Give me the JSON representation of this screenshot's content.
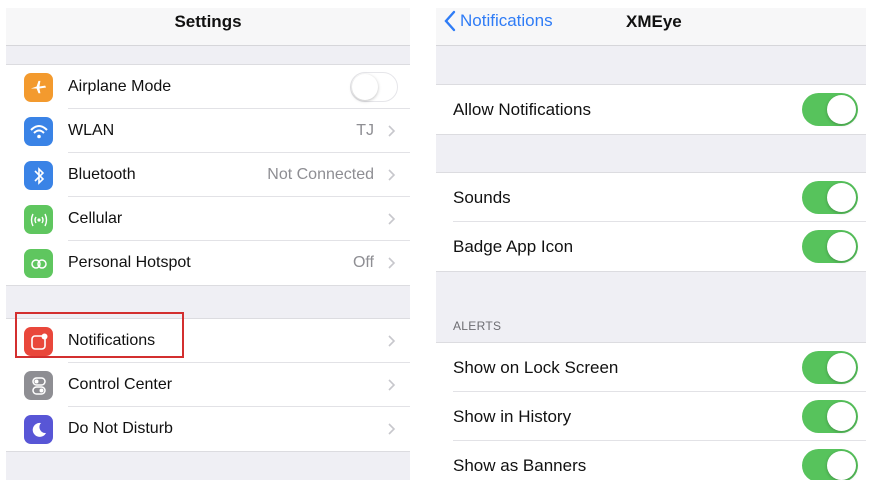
{
  "left_panel": {
    "title": "Settings",
    "groups": [
      {
        "items": [
          {
            "label": "Airplane Mode",
            "icon": "airplane-icon",
            "icon_color": "#f39a2e",
            "value": "",
            "toggle": "off"
          },
          {
            "label": "WLAN",
            "icon": "wifi-icon",
            "icon_color": "#3a83e6",
            "value": "TJ"
          },
          {
            "label": "Bluetooth",
            "icon": "bluetooth-icon",
            "icon_color": "#3a83e6",
            "value": "Not Connected"
          },
          {
            "label": "Cellular",
            "icon": "cellular-icon",
            "icon_color": "#5fc65f",
            "value": ""
          },
          {
            "label": "Personal Hotspot",
            "icon": "hotspot-icon",
            "icon_color": "#5fc65f",
            "value": "Off"
          }
        ]
      },
      {
        "items": [
          {
            "label": "Notifications",
            "icon": "notifications-icon",
            "icon_color": "#e9473b",
            "value": "",
            "highlighted": true
          },
          {
            "label": "Control Center",
            "icon": "control-center-icon",
            "icon_color": "#8e8e93",
            "value": ""
          },
          {
            "label": "Do Not Disturb",
            "icon": "moon-icon",
            "icon_color": "#5856d6",
            "value": ""
          }
        ]
      }
    ],
    "highlight_color": "#d32f2f"
  },
  "right_panel": {
    "back_label": "Notifications",
    "title": "XMEye",
    "accent_color": "#2f7cf6",
    "toggle_color": "#57c35c",
    "group1": [
      {
        "label": "Allow Notifications",
        "toggle": "on"
      }
    ],
    "group2": [
      {
        "label": "Sounds",
        "toggle": "on"
      },
      {
        "label": "Badge App Icon",
        "toggle": "on"
      }
    ],
    "alerts_header": "ALERTS",
    "group3": [
      {
        "label": "Show on Lock Screen",
        "toggle": "on"
      },
      {
        "label": "Show in History",
        "toggle": "on"
      },
      {
        "label": "Show as Banners",
        "toggle": "on"
      }
    ]
  }
}
